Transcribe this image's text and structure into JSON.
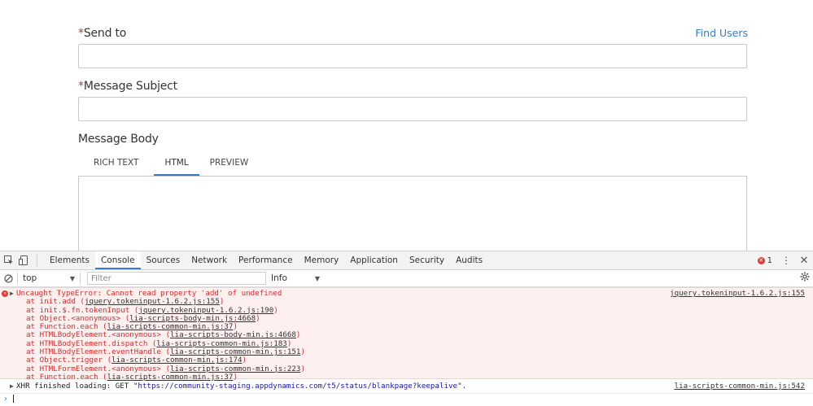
{
  "form": {
    "send_to": {
      "required_mark": "*",
      "label": "Send to",
      "find_users": "Find Users",
      "value": ""
    },
    "subject": {
      "required_mark": "*",
      "label": "Message Subject",
      "value": ""
    },
    "body": {
      "label": "Message Body",
      "tabs": [
        {
          "label": "RICH TEXT",
          "active": false
        },
        {
          "label": "HTML",
          "active": true
        },
        {
          "label": "PREVIEW",
          "active": false
        }
      ]
    }
  },
  "devtools": {
    "tabs": [
      {
        "label": "Elements",
        "active": false
      },
      {
        "label": "Console",
        "active": true
      },
      {
        "label": "Sources",
        "active": false
      },
      {
        "label": "Network",
        "active": false
      },
      {
        "label": "Performance",
        "active": false
      },
      {
        "label": "Memory",
        "active": false
      },
      {
        "label": "Application",
        "active": false
      },
      {
        "label": "Security",
        "active": false
      },
      {
        "label": "Audits",
        "active": false
      }
    ],
    "error_count": "1",
    "error_mark": "✕",
    "more_icon": "⋮",
    "close_icon": "✕",
    "context": "top",
    "filter_placeholder": "Filter",
    "level": "Info",
    "error_message": {
      "text": "Uncaught TypeError: Cannot read property 'add' of undefined",
      "source": "jquery.tokeninput-1.6.2.js:155",
      "stack": [
        {
          "prefix": "at init.add (",
          "link": "jquery.tokeninput-1.6.2.js:155",
          "suffix": ")"
        },
        {
          "prefix": "at init.$.fn.tokenInput (",
          "link": "jquery.tokeninput-1.6.2.js:190",
          "suffix": ")"
        },
        {
          "prefix": "at Object.<anonymous> (",
          "link": "lia-scripts-body-min.js:4668",
          "suffix": ")"
        },
        {
          "prefix": "at Function.each (",
          "link": "lia-scripts-common-min.js:37",
          "suffix": ")"
        },
        {
          "prefix": "at HTMLBodyElement.<anonymous> (",
          "link": "lia-scripts-body-min.js:4668",
          "suffix": ")"
        },
        {
          "prefix": "at HTMLBodyElement.dispatch (",
          "link": "lia-scripts-common-min.js:183",
          "suffix": ")"
        },
        {
          "prefix": "at HTMLBodyElement.eventHandle (",
          "link": "lia-scripts-common-min.js:151",
          "suffix": ")"
        },
        {
          "prefix": "at Object.trigger (",
          "link": "lia-scripts-common-min.js:174",
          "suffix": ")"
        },
        {
          "prefix": "at HTMLFormElement.<anonymous> (",
          "link": "lia-scripts-common-min.js:223",
          "suffix": ")"
        },
        {
          "prefix": "at Function.each (",
          "link": "lia-scripts-common-min.js:37",
          "suffix": ")"
        }
      ]
    },
    "xhr_message": {
      "prefix": "XHR finished loading: GET \"",
      "url": "https://community-staging.appdynamics.com/t5/status/blankpage?keepalive",
      "suffix": "\".",
      "source": "lia-scripts-common-min.js:542"
    },
    "prompt": "›"
  }
}
